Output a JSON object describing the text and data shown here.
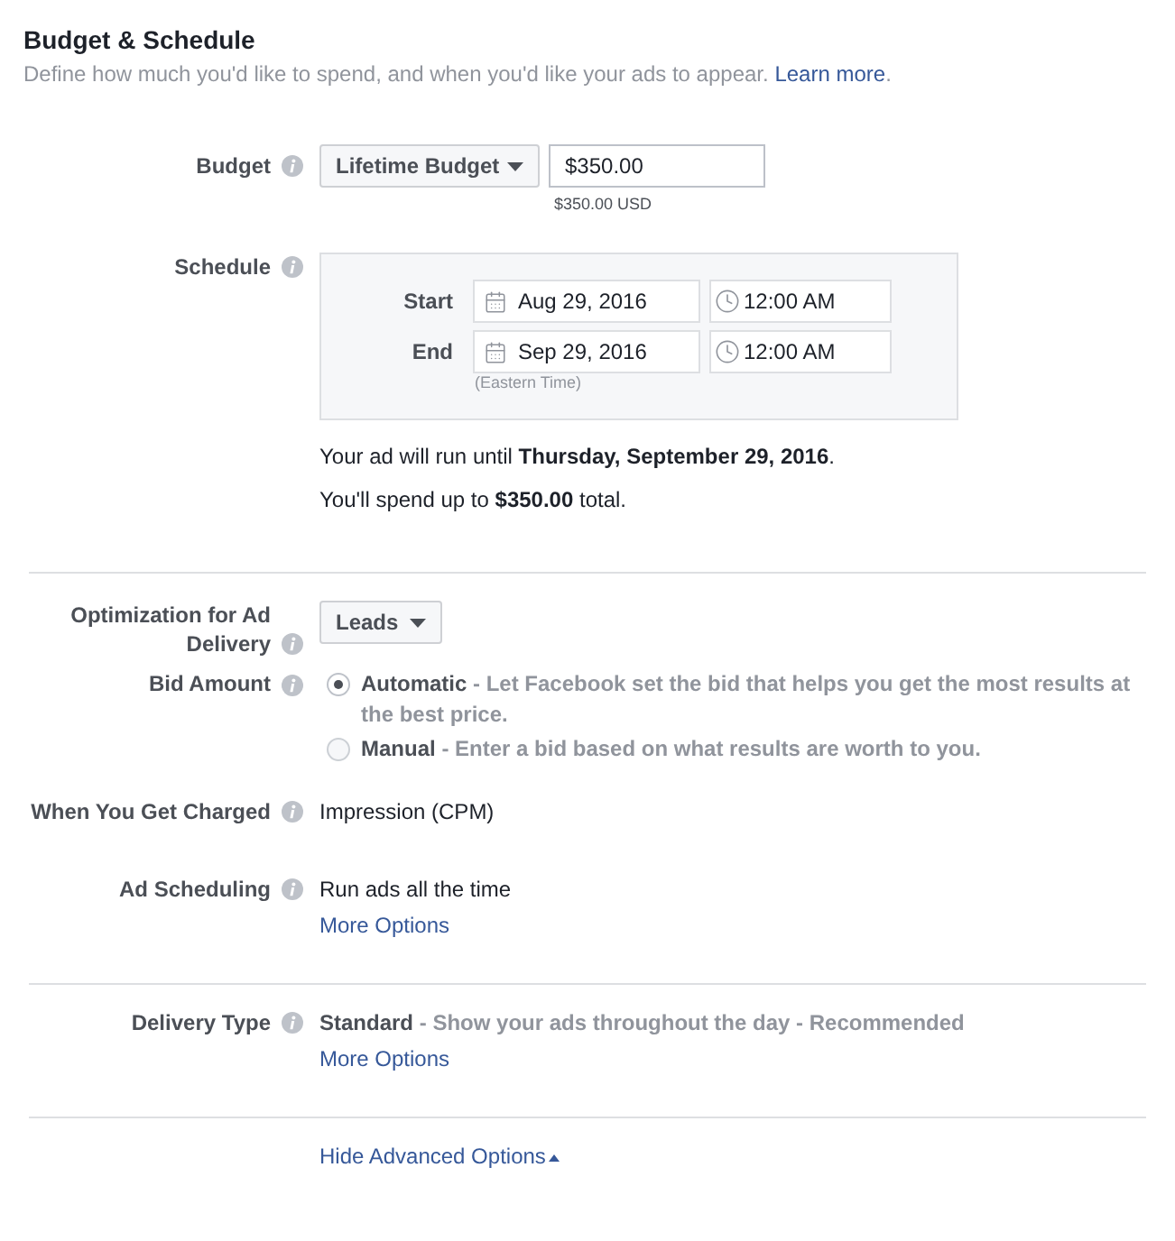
{
  "header": {
    "title": "Budget & Schedule",
    "description": "Define how much you'd like to spend, and when you'd like your ads to appear.",
    "link": "Learn more",
    "link_end": "."
  },
  "budget": {
    "label": "Budget",
    "type_dropdown": "Lifetime Budget",
    "amount": "$350.00",
    "amount_note": "$350.00 USD"
  },
  "schedule": {
    "label": "Schedule",
    "rows": [
      {
        "label": "Start",
        "date": "Aug 29, 2016",
        "time": "12:00 AM"
      },
      {
        "label": "End",
        "date": "Sep 29, 2016",
        "time": "12:00 AM"
      }
    ],
    "timezone": "(Eastern Time)",
    "summary": [
      "Your ad will run until **Thursday, September 29, 2016**.",
      "You'll spend up to **$350.00** total."
    ]
  },
  "optimization": {
    "label": "Optimization for Ad Delivery",
    "dropdown": "Leads"
  },
  "bid_amount": {
    "label": "Bid Amount",
    "options": [
      {
        "title": "Automatic",
        "description": "- Let Facebook set the bid that helps you get the most results at the best price.",
        "selected": true
      },
      {
        "title": "Manual",
        "description": "- Enter a bid based on what results are worth to you.",
        "selected": false
      }
    ]
  },
  "charged": {
    "label": "When You Get Charged",
    "value": "Impression (CPM)"
  },
  "ad_scheduling": {
    "label": "Ad Scheduling",
    "value": "Run ads all the time",
    "link": "More Options"
  },
  "delivery_type": {
    "label": "Delivery Type",
    "title": "Standard",
    "description": "- Show your ads throughout the day - Recommended",
    "link": "More Options"
  },
  "footer_link": "Hide Advanced Options"
}
